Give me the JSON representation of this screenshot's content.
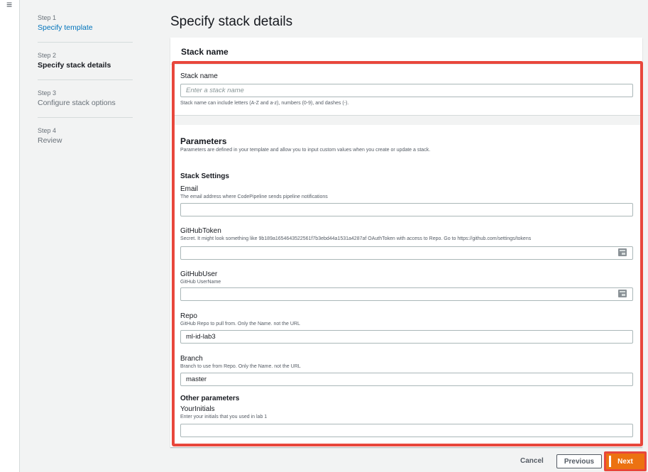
{
  "nav": {
    "menu_icon": "hamburger-icon"
  },
  "steps": [
    {
      "num": "Step 1",
      "label": "Specify template",
      "state": "link"
    },
    {
      "num": "Step 2",
      "label": "Specify stack details",
      "state": "current"
    },
    {
      "num": "Step 3",
      "label": "Configure stack options",
      "state": "muted"
    },
    {
      "num": "Step 4",
      "label": "Review",
      "state": "muted"
    }
  ],
  "page_title": "Specify stack details",
  "stack_name_panel": {
    "header": "Stack name",
    "label": "Stack name",
    "placeholder": "Enter a stack name",
    "value": "",
    "hint": "Stack name can include letters (A-Z and a-z), numbers (0-9), and dashes (-)."
  },
  "parameters": {
    "heading": "Parameters",
    "description": "Parameters are defined in your template and allow you to input custom values when you create or update a stack.",
    "stack_settings_heading": "Stack Settings",
    "other_parameters_heading": "Other parameters",
    "email": {
      "label": "Email",
      "desc": "The email address where CodePipeline sends pipeline notifications",
      "value": ""
    },
    "github_token": {
      "label": "GitHubToken",
      "desc": "Secret. It might look something like 9b189a1654643522561f7b3ebd44a1531a4287af OAuthToken with access to Repo. Go to https://github.com/settings/tokens",
      "value": ""
    },
    "github_user": {
      "label": "GitHubUser",
      "desc": "GitHub UserName",
      "value": ""
    },
    "repo": {
      "label": "Repo",
      "desc": "GitHub Repo to pull from. Only the Name. not the URL",
      "value": "ml-id-lab3"
    },
    "branch": {
      "label": "Branch",
      "desc": "Branch to use from Repo. Only the Name. not the URL",
      "value": "master"
    },
    "your_initials": {
      "label": "YourInitials",
      "desc": "Enter your initials that you used in lab 1",
      "value": ""
    }
  },
  "footer": {
    "cancel": "Cancel",
    "previous": "Previous",
    "next": "Next"
  },
  "colors": {
    "accent": "#ec7211",
    "link": "#0073bb",
    "highlight": "#e8473c"
  }
}
